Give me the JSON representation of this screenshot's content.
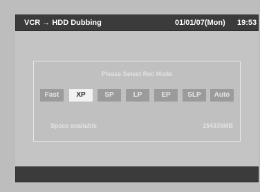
{
  "header": {
    "title": "VCR → HDD Dubbing",
    "date": "01/01/07(Mon)",
    "time": "19:53"
  },
  "dialog": {
    "prompt": "Please Select Rec Mode",
    "modes": [
      {
        "label": "Fast",
        "selected": false
      },
      {
        "label": "XP",
        "selected": true
      },
      {
        "label": "SP",
        "selected": false
      },
      {
        "label": "LP",
        "selected": false
      },
      {
        "label": "EP",
        "selected": false
      },
      {
        "label": "SLP",
        "selected": false
      },
      {
        "label": "Auto",
        "selected": false
      }
    ],
    "space_label": "Space available",
    "space_value": "154335MB"
  },
  "colors": {
    "background": "#bdbdbd",
    "header": "#3b3b3b",
    "mode_button": "#9b9b9b",
    "mode_selected": "#f2f2f2"
  }
}
